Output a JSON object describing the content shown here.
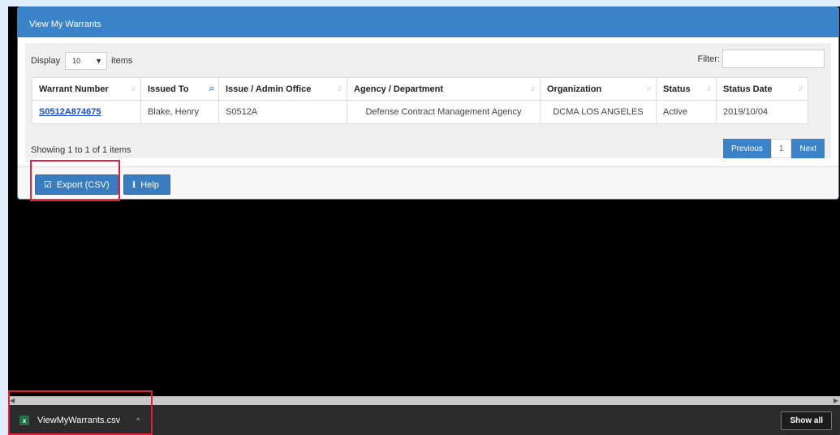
{
  "panel": {
    "title": "View My Warrants"
  },
  "controls": {
    "display_label": "Display",
    "display_value": "10",
    "items_label": "items",
    "filter_label": "Filter:",
    "filter_value": ""
  },
  "table": {
    "headers": [
      "Warrant Number",
      "Issued To",
      "Issue / Admin Office",
      "Agency / Department",
      "Organization",
      "Status",
      "Status Date"
    ],
    "rows": [
      [
        "S0512A874675",
        "Blake, Henry",
        "S0512A",
        "Defense Contract Management Agency",
        "DCMA LOS ANGELES",
        "Active",
        "2019/10/04"
      ]
    ]
  },
  "footer": {
    "showing": "Showing 1 to 1 of 1 items",
    "prev_label": "Previous",
    "page": "1",
    "next_label": "Next"
  },
  "actions": {
    "export_label": "Export (CSV)",
    "help_label": "Help"
  },
  "downloads": {
    "file_name": "ViewMyWarrants.csv",
    "show_all_label": "Show all"
  }
}
